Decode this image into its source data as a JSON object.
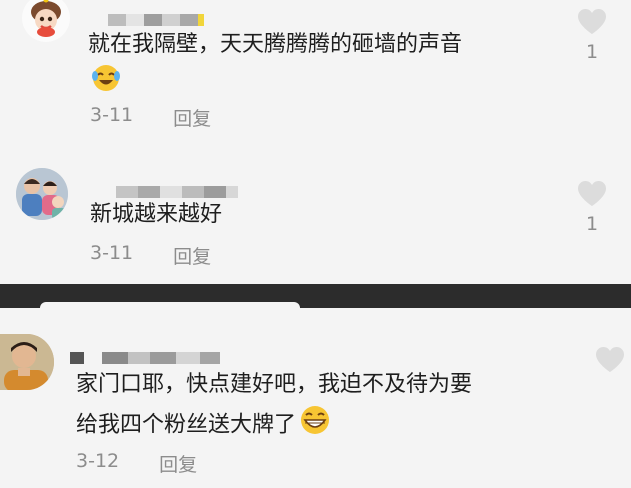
{
  "comments": [
    {
      "text": "就在我隔壁，天天腾腾腾的砸墙的声音",
      "emoji": "laughing-crying-emoji",
      "date": "3-11",
      "reply_label": "回复",
      "likes": "1"
    },
    {
      "text": "新城越来越好",
      "date": "3-11",
      "reply_label": "回复",
      "likes": "1"
    },
    {
      "text_line1": "家门口耶，快点建好吧，我迫不及待为要",
      "text_line2": "给我四个粉丝送大牌了",
      "emoji": "grinning-emoji",
      "date": "3-12",
      "reply_label": "回复"
    }
  ],
  "colors": {
    "background": "#f4f4f4",
    "text": "#1e1e1e",
    "meta": "#8c8c8c",
    "divider": "#2c2c2c",
    "heart": "#dcdcdc"
  }
}
